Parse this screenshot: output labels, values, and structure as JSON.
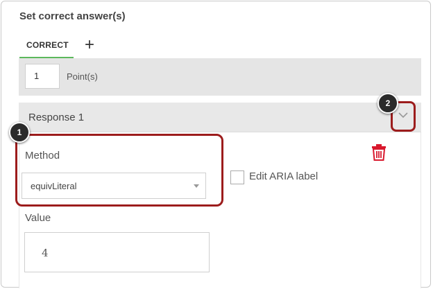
{
  "section": {
    "title": "Set correct answer(s)"
  },
  "tabs": {
    "correct_label": "CORRECT",
    "add_label": "+"
  },
  "points": {
    "value": "1",
    "label": "Point(s)"
  },
  "response": {
    "title": "Response 1",
    "method_label": "Method",
    "method_value": "equivLiteral",
    "aria_label": "Edit ARIA label",
    "aria_checked": false,
    "value_label": "Value",
    "value": "4"
  },
  "callouts": [
    "1",
    "2"
  ],
  "colors": {
    "callout_border": "#9c1c1c",
    "tab_underline": "#5cb85c",
    "trash": "#d9182d"
  },
  "icons": [
    "chevron-down-icon",
    "trash-icon",
    "plus-icon"
  ]
}
